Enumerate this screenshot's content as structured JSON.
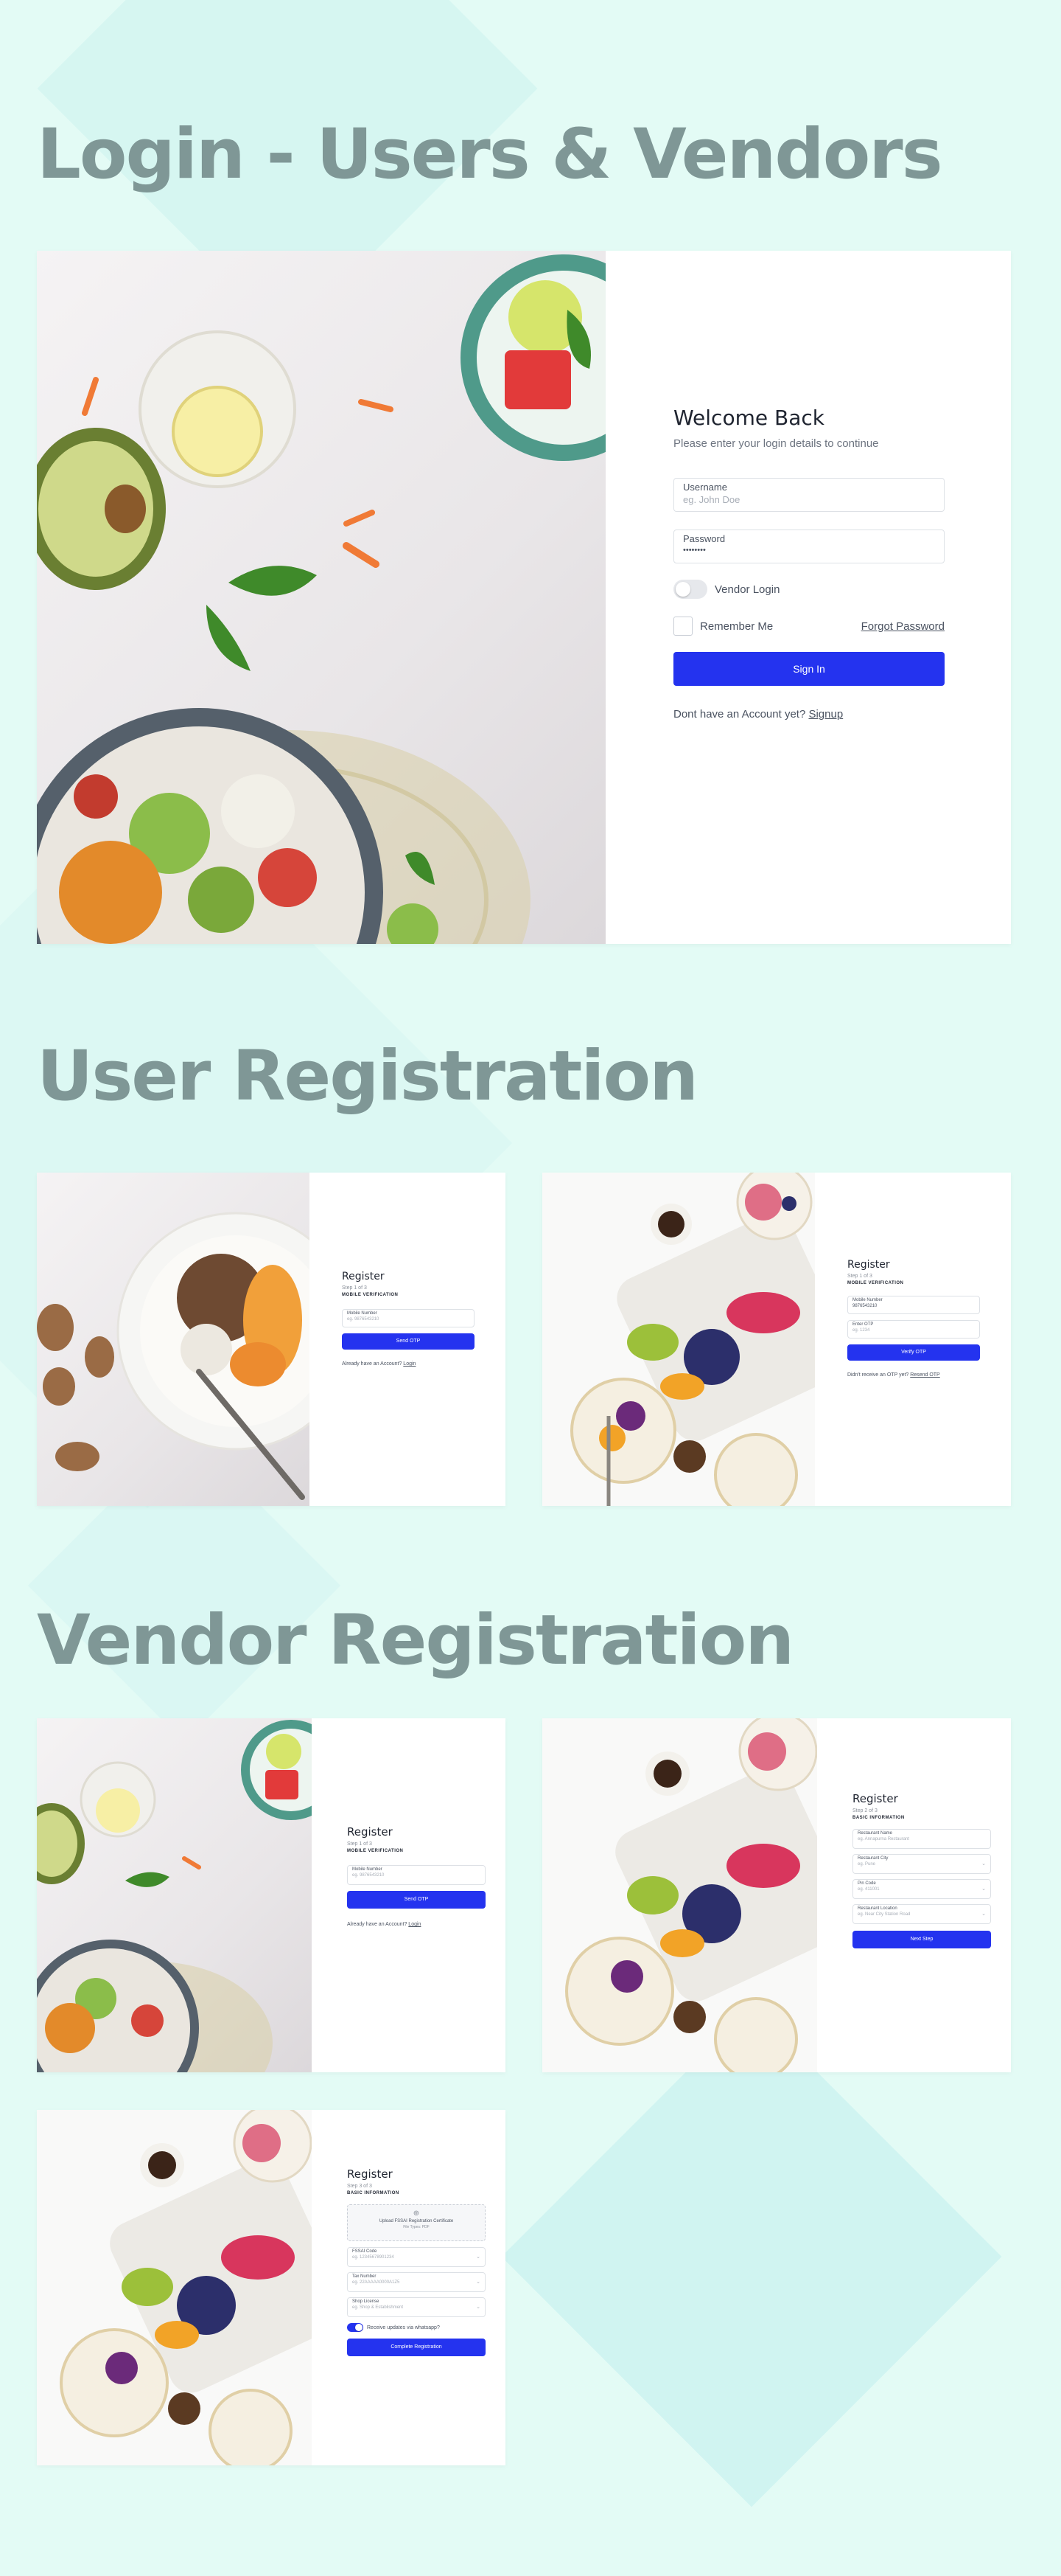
{
  "sections": {
    "login": "Login - Users & Vendors",
    "user_registration": "User Registration",
    "vendor_registration": "Vendor Registration"
  },
  "login": {
    "title": "Welcome Back",
    "subtitle": "Please enter your login details to continue",
    "username_label": "Username",
    "username_placeholder": "eg. John Doe",
    "password_label": "Password",
    "password_value": "••••••••",
    "vendor_toggle_label": "Vendor Login",
    "remember_label": "Remember Me",
    "forgot_link": "Forgot Password",
    "sign_in_button": "Sign In",
    "signup_prompt": "Dont have an Account yet?",
    "signup_link": "Signup"
  },
  "user_reg_step1": {
    "title": "Register",
    "step": "Step 1 of 3",
    "section": "MOBILE VERIFICATION",
    "mobile_label": "Mobile Number",
    "mobile_placeholder": "eg. 9876543210",
    "send_otp_button": "Send OTP",
    "login_prompt": "Already have an Account?",
    "login_link": "Login"
  },
  "user_reg_step2": {
    "title": "Register",
    "step": "Step 1 of 3",
    "section": "MOBILE VERIFICATION",
    "mobile_label": "Mobile Number",
    "mobile_value": "9876543210",
    "otp_label": "Enter OTP",
    "otp_placeholder": "eg. 1234",
    "verify_button": "Verify OTP",
    "resend_prompt": "Didn't receive an OTP yet?",
    "resend_link": "Resend OTP"
  },
  "vendor_reg_step1": {
    "title": "Register",
    "step": "Step 1 of 3",
    "section": "MOBILE VERIFICATION",
    "mobile_label": "Mobile Number",
    "mobile_placeholder": "eg. 9876543210",
    "send_otp_button": "Send OTP",
    "login_prompt": "Already have an Account?",
    "login_link": "Login"
  },
  "vendor_reg_step2": {
    "title": "Register",
    "step": "Step 2 of 3",
    "section": "BASIC INFORMATION",
    "fields": [
      {
        "label": "Restaurant Name",
        "placeholder": "eg. Annapurna Restaurant"
      },
      {
        "label": "Restaurant City",
        "placeholder": "eg. Pune"
      },
      {
        "label": "Pin Code",
        "placeholder": "eg. 411001"
      },
      {
        "label": "Restaurant Location",
        "placeholder": "eg. Near City Station Road"
      }
    ],
    "next_button": "Next Step"
  },
  "vendor_reg_step3": {
    "title": "Register",
    "step": "Step 3 of 3",
    "section": "BASIC INFORMATION",
    "upload_title": "Upload FSSAI Registration Certificate",
    "upload_hint": "File Types: PDF",
    "fields": [
      {
        "label": "FSSAI Code",
        "placeholder": "eg. 12345678901234"
      },
      {
        "label": "Tax Number",
        "placeholder": "eg. 22AAAAA0000A1Z5"
      },
      {
        "label": "Shop License",
        "placeholder": "eg. Shop & Establishment"
      }
    ],
    "whatsapp_label": "Receive updates via whatsapp?",
    "complete_button": "Complete Registration"
  },
  "colors": {
    "background": "#e3fbf5",
    "heading": "#7f9796",
    "accent": "#2433ef"
  }
}
